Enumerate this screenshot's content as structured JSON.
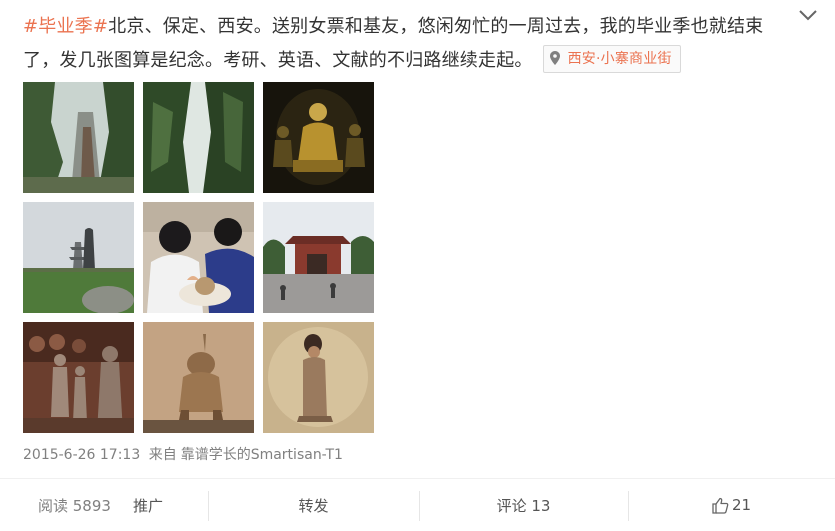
{
  "post": {
    "hashtag": "#毕业季#",
    "text": "北京、保定、西安。送别女票和基友，悠闲匆忙的一周过去，我的毕业季也就结束了，发几张图算是纪念。考研、英语、文献的不归路继续走起。",
    "location": "西安·小寨商业街",
    "timestamp": "2015-6-26 17:13",
    "source_prefix": "来自",
    "source": "靠谱学长的Smartisan-T1"
  },
  "actions": {
    "read_label": "阅读 5893",
    "promote_label": "推广",
    "forward_label": "转发",
    "comment_label": "评论 13",
    "like_count": "21"
  },
  "icons": {
    "location": "map-pin-icon",
    "more": "chevron-down-icon",
    "like": "thumbs-up-icon"
  },
  "colors": {
    "accent": "#eb7350",
    "text": "#333333",
    "muted": "#808080"
  }
}
